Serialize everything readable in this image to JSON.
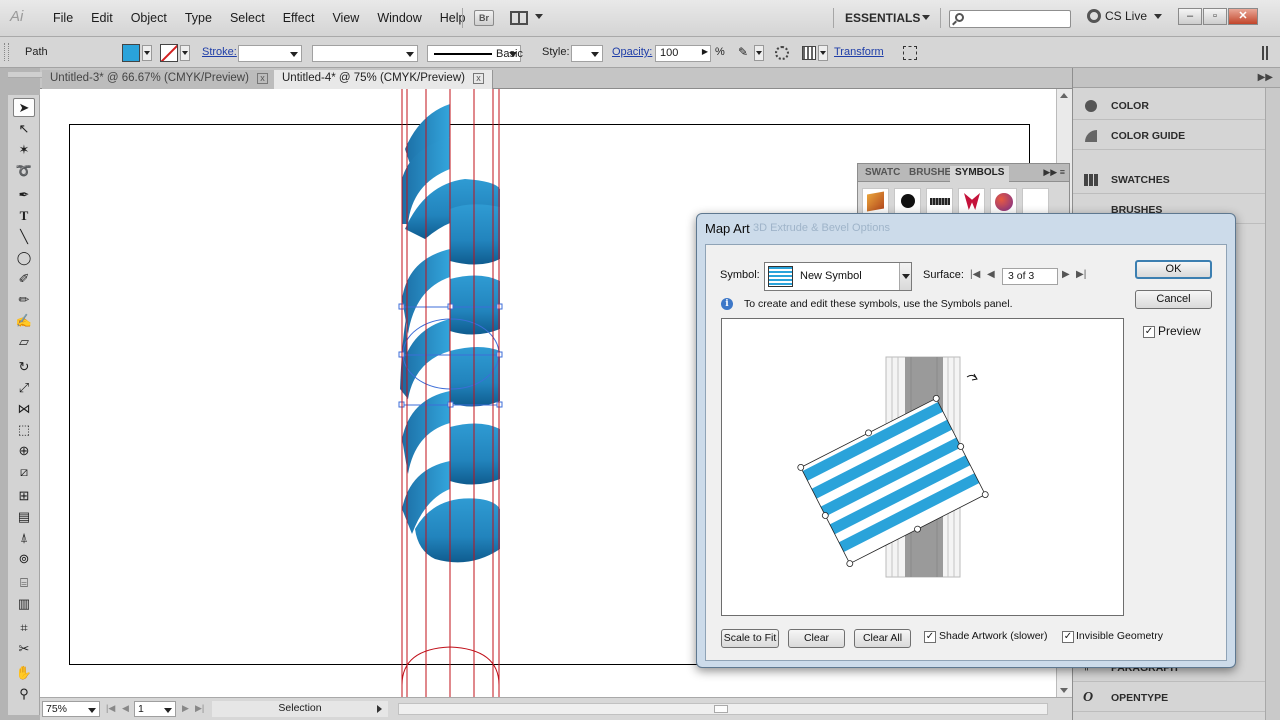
{
  "app": {
    "logo": "Ai"
  },
  "menu": [
    "File",
    "Edit",
    "Object",
    "Type",
    "Select",
    "Effect",
    "View",
    "Window",
    "Help"
  ],
  "toolbar": {
    "bridge": "Br",
    "workspace": "ESSENTIALS",
    "cs_live": "CS Live"
  },
  "window_buttons": {
    "minimize": "–",
    "restore": "▫",
    "close": "✕"
  },
  "control": {
    "selection_type": "Path",
    "stroke_label": "Stroke:",
    "brush_label": "Basic",
    "style_label": "Style:",
    "opacity_label": "Opacity:",
    "opacity_value": "100",
    "opacity_unit": "%",
    "transform_label": "Transform",
    "fill_color": "#2aa3da"
  },
  "tabs": [
    {
      "label": "Untitled-3* @ 66.67% (CMYK/Preview)"
    },
    {
      "label": "Untitled-4* @ 75% (CMYK/Preview)"
    }
  ],
  "status": {
    "zoom": "75%",
    "artboard": "1",
    "tool": "Selection"
  },
  "dock": {
    "items": [
      "COLOR",
      "COLOR GUIDE",
      "SWATCHES",
      "BRUSHES",
      "PARAGRAPH",
      "OPENTYPE"
    ]
  },
  "symbols_panel": {
    "tabs": [
      "SWATC",
      "BRUSHE",
      "SYMBOLS"
    ]
  },
  "dialog": {
    "title": "Map Art",
    "ghost_title": "3D Extrude & Bevel Options",
    "symbol_label": "Symbol:",
    "symbol_value": "New Symbol",
    "surface_label": "Surface:",
    "surface_value": "3 of 3",
    "info_text": "To create and edit these symbols, use the Symbols panel.",
    "ok": "OK",
    "cancel": "Cancel",
    "preview_label": "Preview",
    "preview_checked": "✓",
    "scale_to_fit": "Scale to Fit",
    "clear": "Clear",
    "clear_all": "Clear All",
    "shade_artwork": "Shade Artwork (slower)",
    "invisible_geometry": "Invisible Geometry",
    "shade_checked": "✓",
    "invisible_checked": "✓"
  },
  "colors": {
    "accent": "#2aa3da",
    "guide": "#c0101a",
    "dialog_frame": "#ccdbea"
  }
}
